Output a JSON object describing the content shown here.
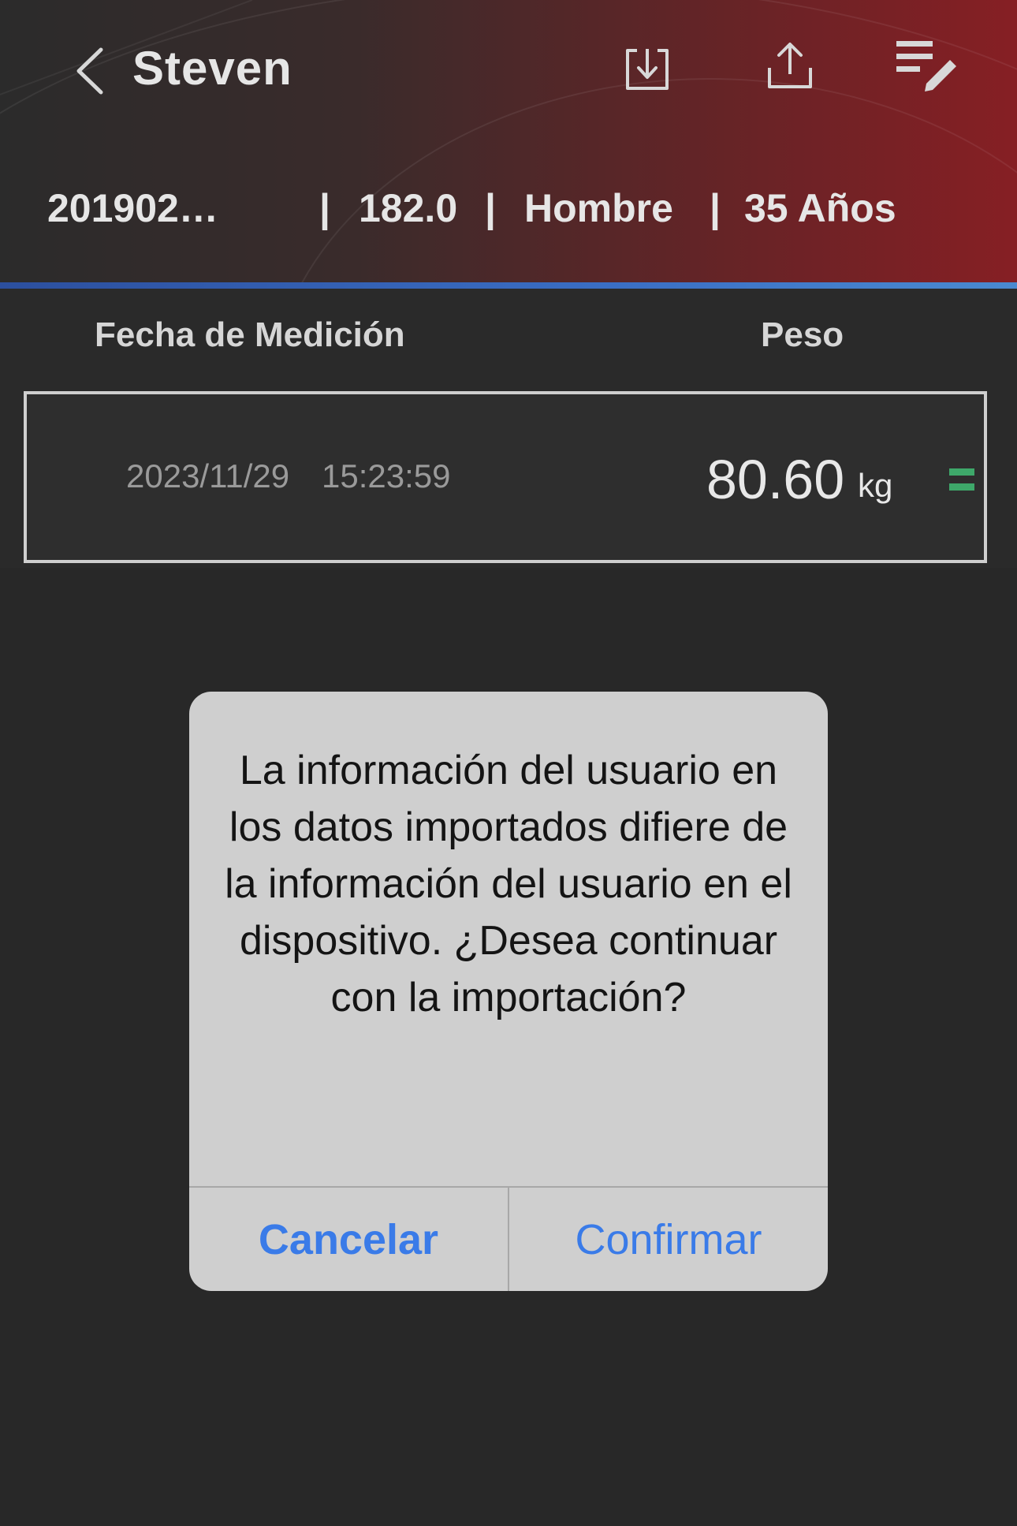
{
  "header": {
    "title": "Steven",
    "icons": {
      "back": "chevron-left-icon",
      "import": "import-icon",
      "export": "export-icon",
      "edit": "edit-list-icon"
    },
    "info": {
      "id": "201902…",
      "sep1": "|",
      "height": "182.0",
      "sep2": "|",
      "gender": "Hombre",
      "sep3": "|",
      "age": "35 Años"
    }
  },
  "table": {
    "col_date": "Fecha de Medición",
    "col_weight": "Peso",
    "records": [
      {
        "date": "2023/11/29",
        "time": "15:23:59",
        "weight": "80.60",
        "unit": "kg",
        "status_color": "#3ea86a"
      }
    ]
  },
  "dialog": {
    "message": "La información del usuario en los datos importados difiere de la información del usuario en el dispositivo. ¿Desea continuar con la importación?",
    "cancel_label": "Cancelar",
    "confirm_label": "Confirmar",
    "accent_color": "#3a7be8"
  }
}
